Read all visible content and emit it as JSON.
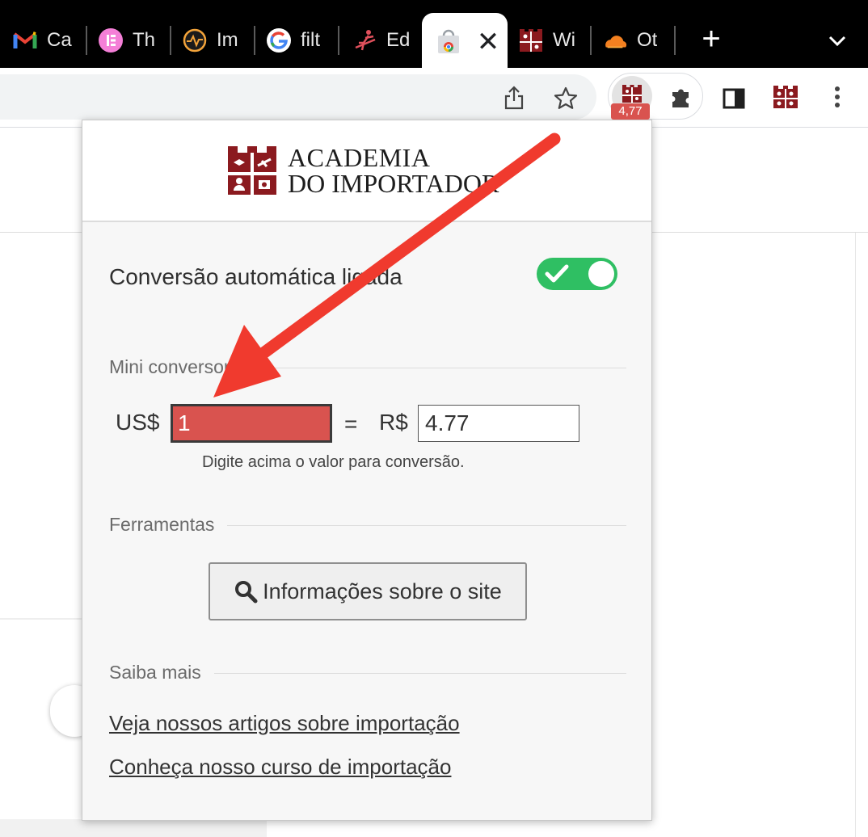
{
  "tabs": [
    {
      "title": "Ca",
      "icon": "gmail-icon"
    },
    {
      "title": "Th",
      "icon": "elementor-icon"
    },
    {
      "title": "Im",
      "icon": "pulse-monitor-icon"
    },
    {
      "title": "filt",
      "icon": "google-icon"
    },
    {
      "title": "Ed",
      "icon": "desk-figure-icon"
    },
    {
      "title": "",
      "icon": "chrome-web-store-icon",
      "active": true
    },
    {
      "title": "Wi",
      "icon": "academia-importador-icon"
    },
    {
      "title": "Ot",
      "icon": "cloudflare-icon"
    }
  ],
  "tab_close_glyph": "✕",
  "new_tab_glyph": "+",
  "extension": {
    "badge": "4,77",
    "badge_color": "#d9534f"
  },
  "popup": {
    "brand": {
      "line1": "ACADEMIA",
      "line2": "DO IMPORTADOR",
      "color": "#8b1a1f"
    },
    "auto_conversion": {
      "label": "Conversão automática ligada",
      "enabled": true,
      "color": "#2fbf63"
    },
    "mini_converter": {
      "section_label": "Mini conversor",
      "from_currency": "US$",
      "from_value": "1",
      "equals": "=",
      "to_currency": "R$",
      "to_value": "4.77",
      "hint": "Digite acima o valor para conversão."
    },
    "tools": {
      "section_label": "Ferramentas",
      "site_info_button": "Informações sobre o site"
    },
    "learn_more": {
      "section_label": "Saiba mais",
      "links": [
        "Veja nossos artigos sobre importação",
        "Conheça nosso curso de importação"
      ]
    }
  },
  "annotation": {
    "color": "#f03a2e"
  }
}
